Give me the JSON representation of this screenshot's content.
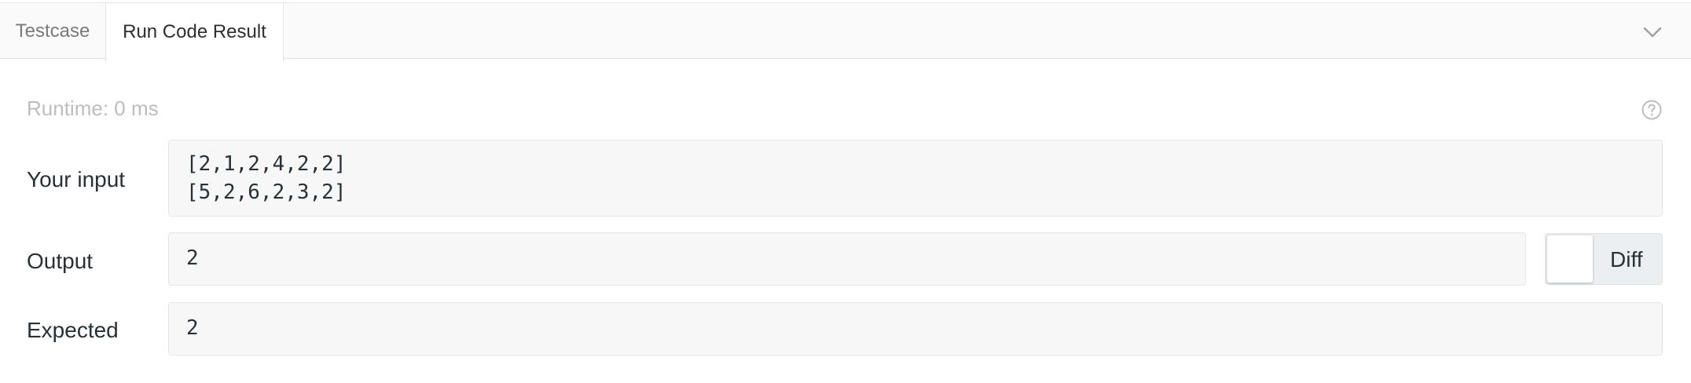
{
  "tabs": {
    "testcase_label": "Testcase",
    "result_label": "Run Code Result",
    "active": "Run Code Result"
  },
  "icons": {
    "collapse": "chevron-down-icon",
    "help": "question-circle-icon"
  },
  "result": {
    "runtime": "Runtime: 0 ms",
    "input": {
      "label": "Your input",
      "lines": [
        "[2,1,2,4,2,2]",
        "[5,2,6,2,3,2]"
      ]
    },
    "output": {
      "label": "Output",
      "value": "2"
    },
    "expected": {
      "label": "Expected",
      "value": "2"
    },
    "diff": {
      "label": "Diff",
      "enabled": false
    }
  },
  "colors": {
    "tabbar_bg": "#fafafa",
    "field_bg": "#f7f7f7",
    "muted_text": "#bdbdbd",
    "label_text": "#263238"
  }
}
